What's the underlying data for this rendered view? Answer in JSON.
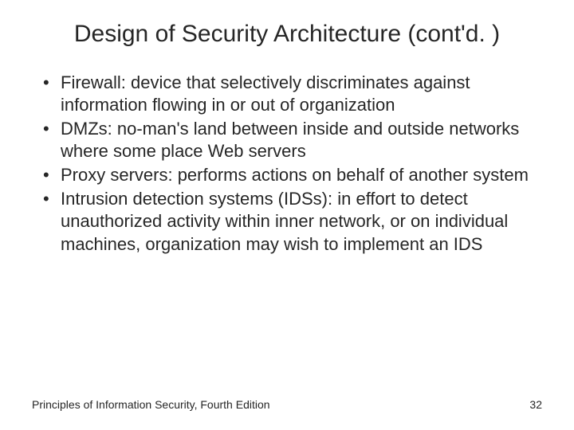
{
  "slide": {
    "title": "Design of Security Architecture (cont'd. )",
    "bullets": [
      "Firewall: device that selectively discriminates against information flowing in or out of organization",
      "DMZs: no-man's land between inside and outside networks where some place Web servers",
      "Proxy servers: performs actions on behalf of another system",
      "Intrusion detection systems (IDSs): in effort to detect unauthorized activity within inner network, or on individual machines, organization may wish to implement an IDS"
    ],
    "footer_source": "Principles of Information Security, Fourth Edition",
    "page_number": "32"
  }
}
